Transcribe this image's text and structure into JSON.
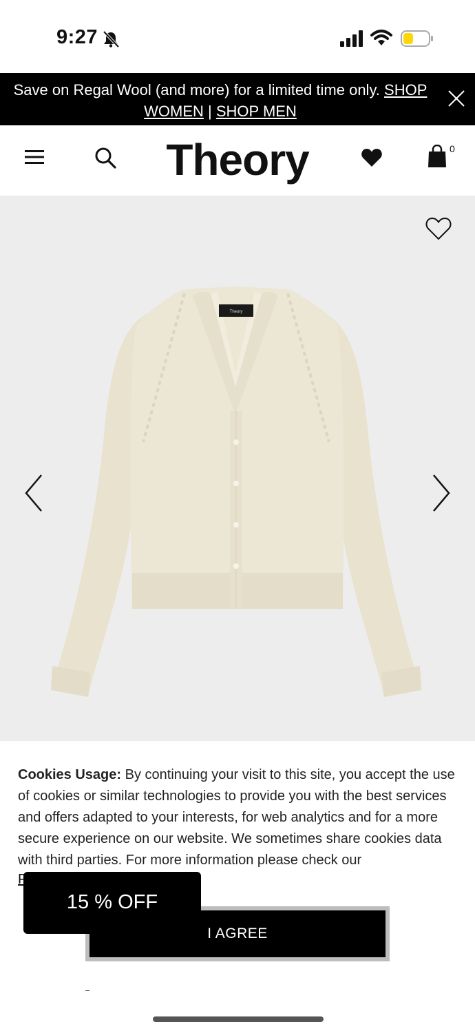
{
  "status_bar": {
    "time": "9:27",
    "icons": [
      "bell-muted-icon",
      "signal-icon",
      "wifi-icon",
      "battery-icon"
    ]
  },
  "promo": {
    "text": "Save on Regal Wool (and more) for a limited time only. ",
    "link_women": "SHOP WOMEN",
    "separator": " | ",
    "link_men": "SHOP MEN"
  },
  "header": {
    "logo": "Theory",
    "bag_count": "0",
    "icons": [
      "menu-icon",
      "search-icon",
      "heart-icon",
      "bag-icon"
    ]
  },
  "product": {
    "label_text": "Theory",
    "icons": [
      "wishlist-heart-icon",
      "chevron-left-icon",
      "chevron-right-icon"
    ]
  },
  "cookies": {
    "heading": "Cookies Usage:",
    "body": " By continuing your visit to this site, you accept the use of cookies or similar technologies to provide you with the best services and offers adapted to your interests, for web analytics and for a more secure experience on our website. We sometimes share cookies data with third parties. For more information please check our",
    "link_stub": "P",
    "agree_label": "I AGREE"
  },
  "discount": {
    "label": "15 % OFF"
  },
  "colors": {
    "banner_bg": "#000000",
    "product_bg": "#ededed",
    "sweater": "#ece6d4",
    "battery_fill": "#ffd60a"
  }
}
